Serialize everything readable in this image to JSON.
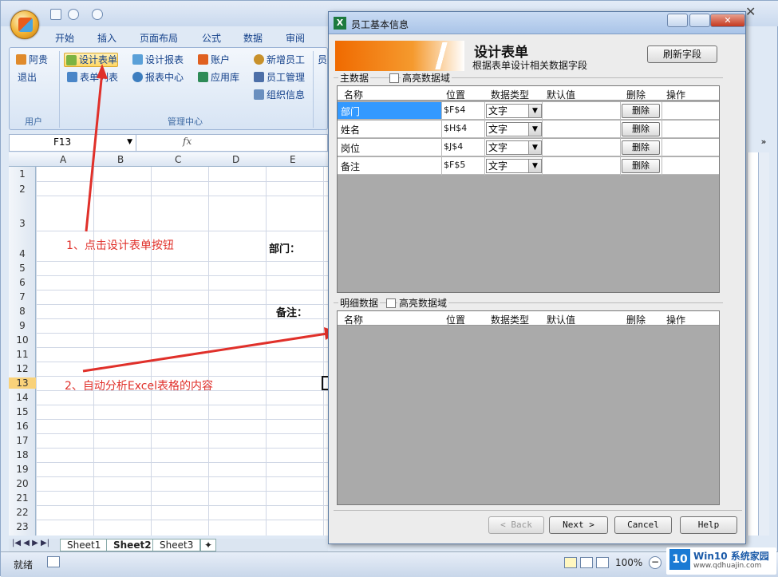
{
  "excel": {
    "tabs": [
      "开始",
      "插入",
      "页面布局",
      "公式",
      "数据",
      "审阅"
    ],
    "ribbon": {
      "user_group": {
        "label": "用户",
        "items": [
          "阿贵",
          "退出"
        ]
      },
      "manage_group": {
        "label": "管理中心",
        "items": [
          "设计表单",
          "表单列表",
          "设计报表",
          "报表中心",
          "账户",
          "应用库",
          "新增员工",
          "员工管理",
          "组织信息"
        ],
        "active": "设计表单"
      },
      "extra_tab_hint": "员"
    },
    "namebox": "F13",
    "fx": "fx",
    "columns": [
      "A",
      "B",
      "C",
      "D",
      "E"
    ],
    "rows": [
      "1",
      "2",
      "3",
      "4",
      "5",
      "6",
      "7",
      "8",
      "9",
      "10",
      "11",
      "12",
      "13",
      "14",
      "15",
      "16",
      "17",
      "18",
      "19",
      "20",
      "21",
      "22",
      "23"
    ],
    "cells": {
      "dept_label": "部门：",
      "remark_label": "备注："
    },
    "annotations": [
      "1、点击设计表单按钮",
      "2、自动分析Excel表格的内容"
    ],
    "sheets": [
      "Sheet1",
      "Sheet2",
      "Sheet3"
    ],
    "status": "就绪",
    "zoom": "100%"
  },
  "dialog": {
    "title": "员工基本信息",
    "heading": "设计表单",
    "subheading": "根据表单设计相关数据字段",
    "refresh_label": "刷新字段",
    "main_section": {
      "label": "主数据",
      "highlight_label": "高亮数据域"
    },
    "detail_section": {
      "label": "明细数据",
      "highlight_label": "高亮数据域"
    },
    "columns": [
      "名称",
      "位置",
      "数据类型",
      "默认值",
      "删除",
      "操作"
    ],
    "rows": [
      {
        "name": "部门",
        "pos": "$F$4",
        "type": "文字",
        "delete": "删除",
        "selected": true
      },
      {
        "name": "姓名",
        "pos": "$H$4",
        "type": "文字",
        "delete": "删除"
      },
      {
        "name": "岗位",
        "pos": "$J$4",
        "type": "文字",
        "delete": "删除"
      },
      {
        "name": "备注",
        "pos": "$F$5",
        "type": "文字",
        "delete": "删除"
      }
    ],
    "buttons": {
      "back": "< Back",
      "next": "Next >",
      "cancel": "Cancel",
      "help": "Help"
    }
  },
  "watermark": {
    "text": "Win10 系统家园",
    "url": "www.qdhuajin.com"
  },
  "colors": {
    "accent_orange": "#f06a00",
    "annotation_red": "#e0302a",
    "selected_cell": "#3399ff"
  }
}
